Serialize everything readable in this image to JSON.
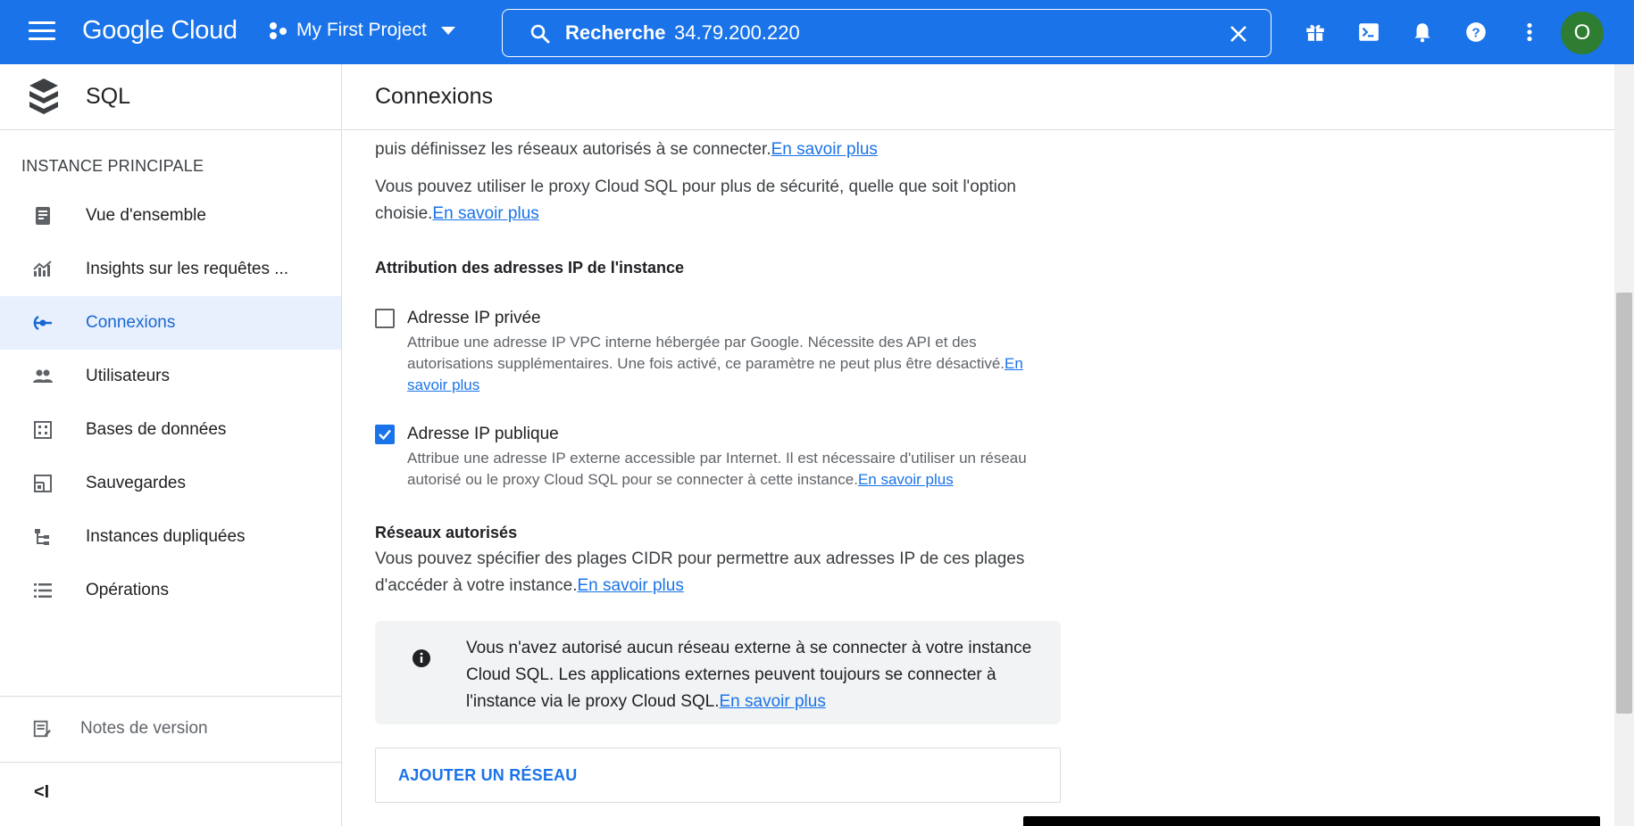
{
  "topbar": {
    "logo": "Google Cloud",
    "project": "My First Project",
    "search_label": "Recherche",
    "search_value": "34.79.200.220",
    "avatar_letter": "O"
  },
  "sidebar": {
    "product_title": "SQL",
    "section_title": "INSTANCE PRINCIPALE",
    "items": [
      {
        "label": "Vue d'ensemble",
        "icon": "dashboard-icon"
      },
      {
        "label": "Insights sur les requêtes ...",
        "icon": "insights-icon"
      },
      {
        "label": "Connexions",
        "icon": "connections-icon",
        "active": true
      },
      {
        "label": "Utilisateurs",
        "icon": "users-icon"
      },
      {
        "label": "Bases de données",
        "icon": "databases-icon"
      },
      {
        "label": "Sauvegardes",
        "icon": "backups-icon"
      },
      {
        "label": "Instances dupliquées",
        "icon": "replicas-icon"
      },
      {
        "label": "Opérations",
        "icon": "operations-icon"
      }
    ],
    "footer_label": "Notes de version",
    "collapse_label": "<I"
  },
  "main": {
    "title": "Connexions",
    "intro_line": "puis définissez les réseaux autorisés à se connecter.",
    "learn_more": "En savoir plus",
    "proxy_text_1": "Vous pouvez utiliser le proxy Cloud SQL pour plus de sécurité, quelle que soit l'option",
    "proxy_text_2": "choisie.",
    "ip_section_title": "Attribution des adresses IP de l'instance",
    "private_ip": {
      "label": "Adresse IP privée",
      "checked": false,
      "desc_1": "Attribue une adresse IP VPC interne hébergée par Google. Nécessite des API et des",
      "desc_2": "autorisations supplémentaires. Une fois activé, ce paramètre ne peut plus être désactivé.",
      "link_a": "En",
      "link_b": "savoir plus"
    },
    "public_ip": {
      "label": "Adresse IP publique",
      "checked": true,
      "desc_1": "Attribue une adresse IP externe accessible par Internet. Il est nécessaire d'utiliser un réseau",
      "desc_2": "autorisé ou le proxy Cloud SQL pour se connecter à cette instance."
    },
    "networks_title": "Réseaux autorisés",
    "networks_text_1": "Vous pouvez spécifier des plages CIDR pour permettre aux adresses IP de ces plages",
    "networks_text_2": "d'accéder à votre instance.",
    "info_1": "Vous n'avez autorisé aucun réseau externe à se connecter à votre instance",
    "info_2": "Cloud SQL. Les applications externes peuvent toujours se connecter à",
    "info_3": "l'instance via le proxy Cloud SQL.",
    "add_network": "AJOUTER UN RÉSEAU"
  },
  "colors": {
    "brand": "#1a73e8",
    "active_bg": "#e8f0fe",
    "active_text": "#1967d2"
  }
}
